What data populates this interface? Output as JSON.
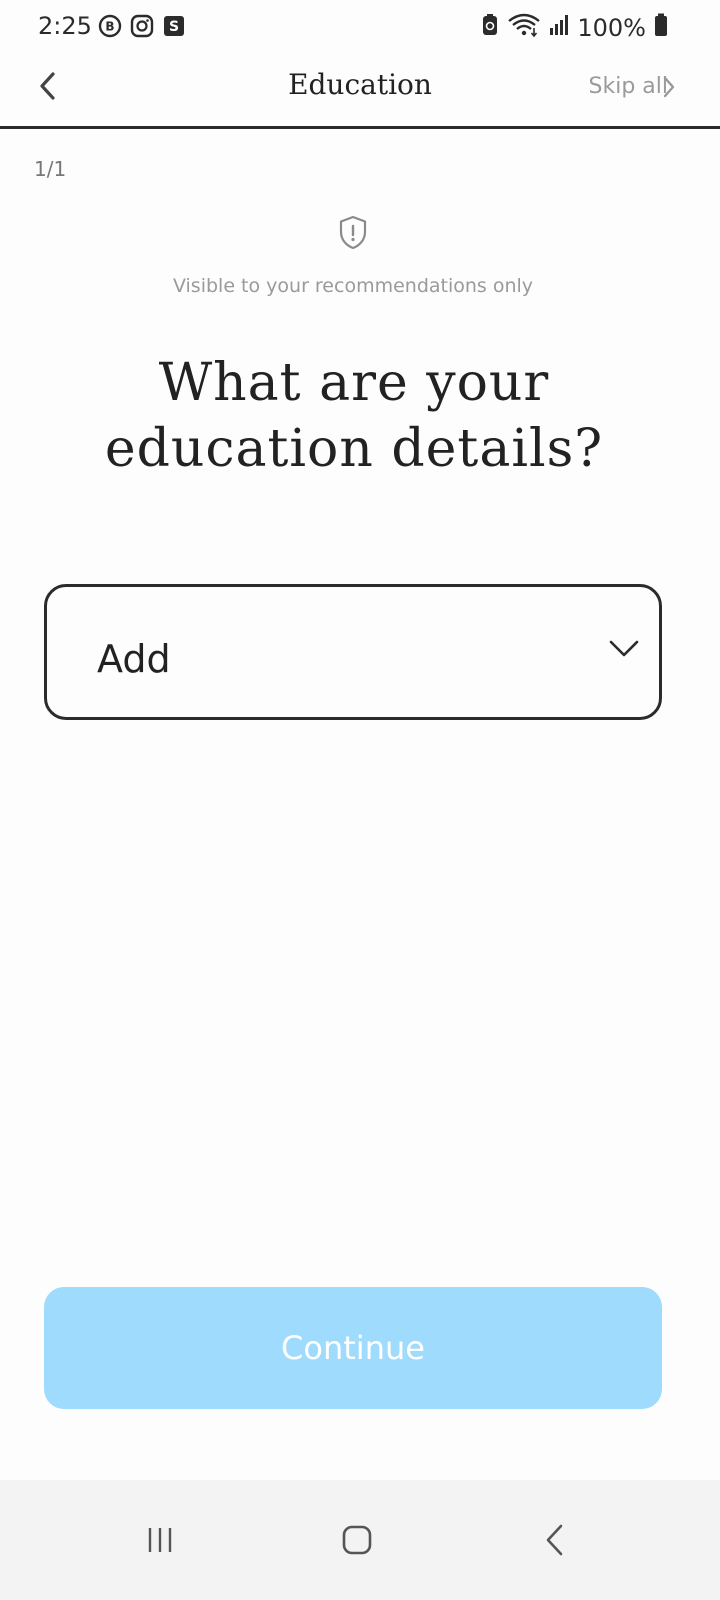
{
  "status_bar": {
    "time": "2:25",
    "battery_pct": "100%",
    "left_icons": [
      "b-messenger-icon",
      "instagram-icon",
      "s-app-icon"
    ],
    "right_icons": [
      "battery-saver-icon",
      "wifi-icon",
      "signal-icon",
      "battery-icon"
    ]
  },
  "header": {
    "title": "Education",
    "skip_label": "Skip all"
  },
  "step": "1/1",
  "visibility_note": "Visible to your recommendations only",
  "question": {
    "line1": "What are your",
    "line2": "education details?"
  },
  "dropdown": {
    "value": "Add"
  },
  "continue_label": "Continue",
  "colors": {
    "accent": "#9fdbfc",
    "text": "#222222",
    "muted": "#9a9a9a"
  }
}
